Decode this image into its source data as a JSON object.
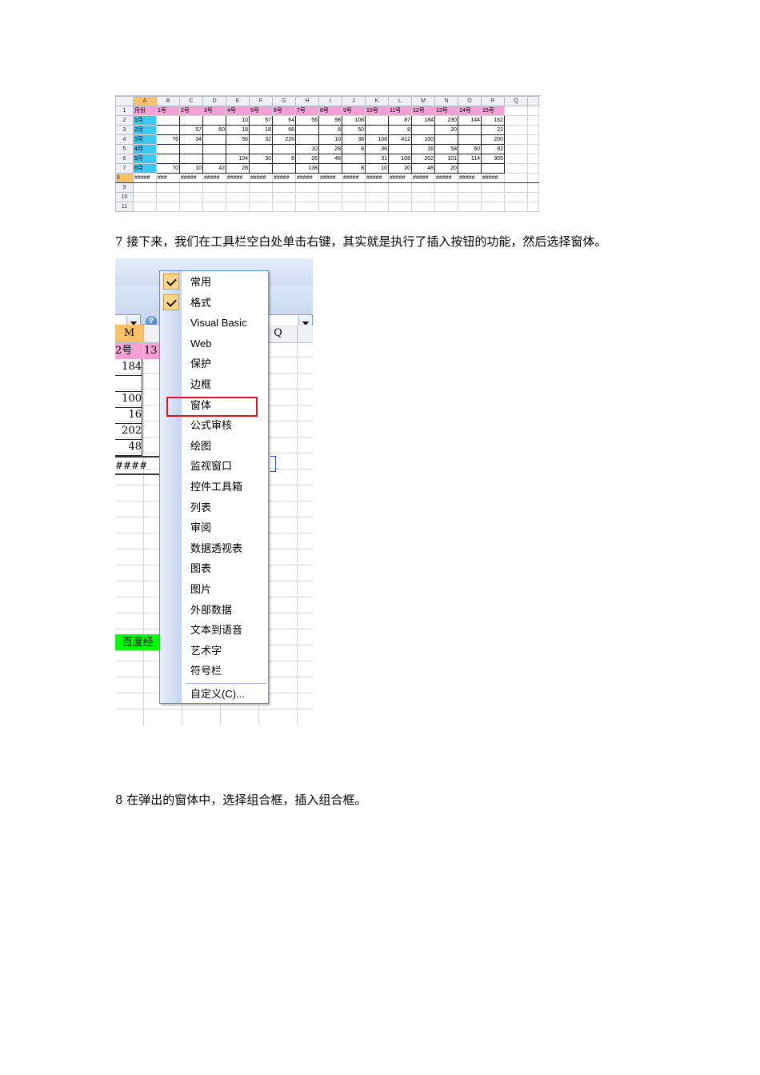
{
  "spreadsheet1": {
    "column_headers": [
      "",
      "A",
      "B",
      "C",
      "D",
      "E",
      "F",
      "G",
      "H",
      "I",
      "J",
      "K",
      "L",
      "M",
      "N",
      "O",
      "P",
      "Q",
      ""
    ],
    "rows": [
      [
        "1",
        "月份",
        "1号",
        "2号",
        "3号",
        "4号",
        "5号",
        "6号",
        "7号",
        "8号",
        "9号",
        "10号",
        "11号",
        "12号",
        "13号",
        "14号",
        "15号",
        "",
        ""
      ],
      [
        "2",
        "1月",
        "",
        "",
        "",
        "10",
        "57",
        "64",
        "56",
        "98",
        "108",
        "",
        "87",
        "184",
        "230",
        "144",
        "162",
        "",
        ""
      ],
      [
        "3",
        "2月",
        "",
        "57",
        "60",
        "18",
        "18",
        "66",
        "",
        "8",
        "50",
        "",
        "8",
        "",
        "20",
        "",
        "22",
        "",
        ""
      ],
      [
        "4",
        "3月",
        "76",
        "34",
        "",
        "56",
        "32",
        "226",
        "",
        "10",
        "38",
        "106",
        "412",
        "100",
        "",
        "",
        "200",
        "",
        ""
      ],
      [
        "5",
        "4月",
        "",
        "",
        "",
        "",
        "",
        "",
        "10",
        "28",
        "8",
        "36",
        "",
        "16",
        "58",
        "60",
        "82",
        "",
        ""
      ],
      [
        "6",
        "5月",
        "",
        "",
        "",
        "104",
        "30",
        "8",
        "26",
        "48",
        "",
        "31",
        "108",
        "202",
        "101",
        "114",
        "305",
        "",
        ""
      ],
      [
        "7",
        "6月",
        "70",
        "10",
        "42",
        "28",
        "",
        "",
        "138",
        "",
        "8",
        "10",
        "20",
        "48",
        "20",
        "",
        "",
        "",
        ""
      ],
      [
        "8",
        "#####",
        "###",
        "#####",
        "#####",
        "#####",
        "#####",
        "#####",
        "#####",
        "#####",
        "#####",
        "#####",
        "#####",
        "#####",
        "#####",
        "#####",
        "#####",
        "",
        ""
      ],
      [
        "9",
        "",
        "",
        "",
        "",
        "",
        "",
        "",
        "",
        "",
        "",
        "",
        "",
        "",
        "",
        "",
        "",
        "",
        ""
      ],
      [
        "10",
        "",
        "",
        "",
        "",
        "",
        "",
        "",
        "",
        "",
        "",
        "",
        "",
        "",
        "",
        "",
        "",
        "",
        ""
      ],
      [
        "11",
        "",
        "",
        "",
        "",
        "",
        "",
        "",
        "",
        "",
        "",
        "",
        "",
        "",
        "",
        "",
        "",
        "",
        ""
      ]
    ]
  },
  "step7_text": "7 接下来，我们在工具栏空白处单击右键，其实就是执行了插入按钮的功能，然后选择窗体。",
  "screenshot2": {
    "help_glyph": "?",
    "col_headers": [
      "M",
      "",
      "Q"
    ],
    "header_row": [
      "2号",
      "13"
    ],
    "m_values": [
      "184",
      "",
      "100",
      "16",
      "202",
      "48"
    ],
    "hash_text": "#### ##",
    "green_cell": "百度经",
    "menu_items": [
      {
        "label": "常用",
        "checked": true
      },
      {
        "label": "格式",
        "checked": true
      },
      {
        "label": "Visual Basic",
        "checked": false
      },
      {
        "label": "Web",
        "checked": false
      },
      {
        "label": "保护",
        "checked": false
      },
      {
        "label": "边框",
        "checked": false
      },
      {
        "label": "窗体",
        "checked": false
      },
      {
        "label": "公式审核",
        "checked": false
      },
      {
        "label": "绘图",
        "checked": false
      },
      {
        "label": "监视窗口",
        "checked": false
      },
      {
        "label": "控件工具箱",
        "checked": false
      },
      {
        "label": "列表",
        "checked": false
      },
      {
        "label": "审阅",
        "checked": false
      },
      {
        "label": "数据透视表",
        "checked": false
      },
      {
        "label": "图表",
        "checked": false
      },
      {
        "label": "图片",
        "checked": false
      },
      {
        "label": "外部数据",
        "checked": false
      },
      {
        "label": "文本到语音",
        "checked": false
      },
      {
        "label": "艺术字",
        "checked": false
      },
      {
        "label": "符号栏",
        "checked": false
      }
    ],
    "customize_label": "自定义(C)...",
    "highlight_color": "#e0141e"
  },
  "step8_text": "8 在弹出的窗体中，选择组合框，插入组合框。"
}
